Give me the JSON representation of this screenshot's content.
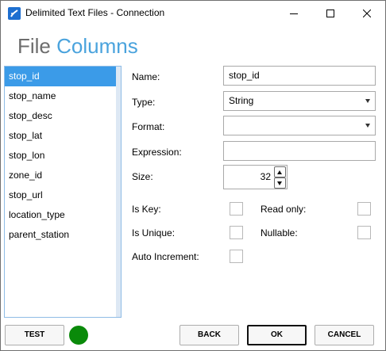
{
  "window": {
    "title": "Delimited Text Files - Connection",
    "icon": "app-logo-icon",
    "controls": [
      "minimize-icon",
      "maximize-icon",
      "close-icon"
    ]
  },
  "header": {
    "title_part1": "File",
    "title_part2": "Columns"
  },
  "columns": {
    "items": [
      {
        "label": "stop_id",
        "selected": true
      },
      {
        "label": "stop_name",
        "selected": false
      },
      {
        "label": "stop_desc",
        "selected": false
      },
      {
        "label": "stop_lat",
        "selected": false
      },
      {
        "label": "stop_lon",
        "selected": false
      },
      {
        "label": "zone_id",
        "selected": false
      },
      {
        "label": "stop_url",
        "selected": false
      },
      {
        "label": "location_type",
        "selected": false
      },
      {
        "label": "parent_station",
        "selected": false
      }
    ]
  },
  "form": {
    "name_label": "Name:",
    "name_value": "stop_id",
    "type_label": "Type:",
    "type_value": "String",
    "format_label": "Format:",
    "format_value": "",
    "expression_label": "Expression:",
    "expression_value": "",
    "size_label": "Size:",
    "size_value": "32",
    "is_key_label": "Is Key:",
    "is_key": false,
    "read_only_label": "Read only:",
    "read_only": false,
    "is_unique_label": "Is Unique:",
    "is_unique": false,
    "nullable_label": "Nullable:",
    "nullable": false,
    "auto_increment_label": "Auto Increment:",
    "auto_increment": false
  },
  "footer": {
    "test_label": "TEST",
    "back_label": "BACK",
    "ok_label": "OK",
    "cancel_label": "CANCEL",
    "status_color": "#0a8a0a"
  },
  "colors": {
    "accent": "#4aa3dd",
    "selection": "#3b9be8"
  }
}
